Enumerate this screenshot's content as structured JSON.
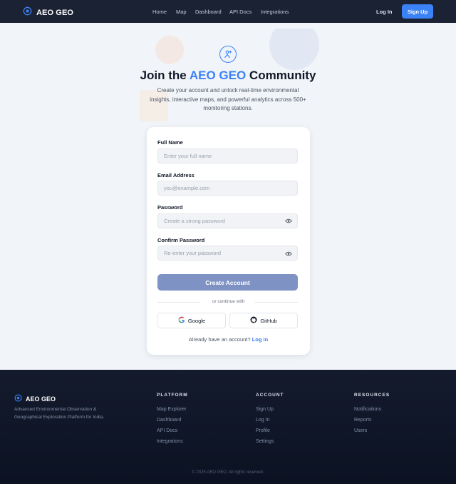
{
  "colors": {
    "accent": "#3b82f6",
    "nav_bg": "#1b2233",
    "footer_bg": "#0b1222",
    "create_button_bg": "#7e92c4"
  },
  "nav": {
    "brand": "AEO GEO",
    "links": [
      "Home",
      "Map",
      "Dashboard",
      "API Docs",
      "Integrations"
    ],
    "login": "Log In",
    "signup": "Sign Up"
  },
  "hero": {
    "title_prefix": "Join the ",
    "title_accent": "AEO GEO",
    "title_suffix": " Community",
    "subtitle": "Create your account and unlock real-time environmental insights, interactive maps, and powerful analytics across 500+ monitoring stations.",
    "icon": "user-plus-icon"
  },
  "form": {
    "full_name": {
      "label": "Full Name",
      "placeholder": "Enter your full name",
      "value": ""
    },
    "email": {
      "label": "Email Address",
      "placeholder": "you@example.com",
      "value": ""
    },
    "password": {
      "label": "Password",
      "placeholder": "Create a strong password",
      "value": "",
      "icon": "eye-icon"
    },
    "confirm_password": {
      "label": "Confirm Password",
      "placeholder": "Re-enter your password",
      "value": "",
      "icon": "eye-icon"
    },
    "submit": "Create Account",
    "divider": "or continue with",
    "google": "Google",
    "github": "GitHub",
    "already_text": "Already have an account?",
    "login_link": "Log in"
  },
  "footer": {
    "brand": "AEO GEO",
    "description": "Advanced Environmental Observation & Geographical Exploration Platform for India.",
    "columns": [
      {
        "heading": "PLATFORM",
        "links": [
          "Map Explorer",
          "Dashboard",
          "API Docs",
          "Integrations"
        ]
      },
      {
        "heading": "ACCOUNT",
        "links": [
          "Sign Up",
          "Log In",
          "Profile",
          "Settings"
        ]
      },
      {
        "heading": "RESOURCES",
        "links": [
          "Notifications",
          "Reports",
          "Users"
        ]
      }
    ],
    "copyright": "© 2025 AEO GEO. All rights reserved."
  }
}
